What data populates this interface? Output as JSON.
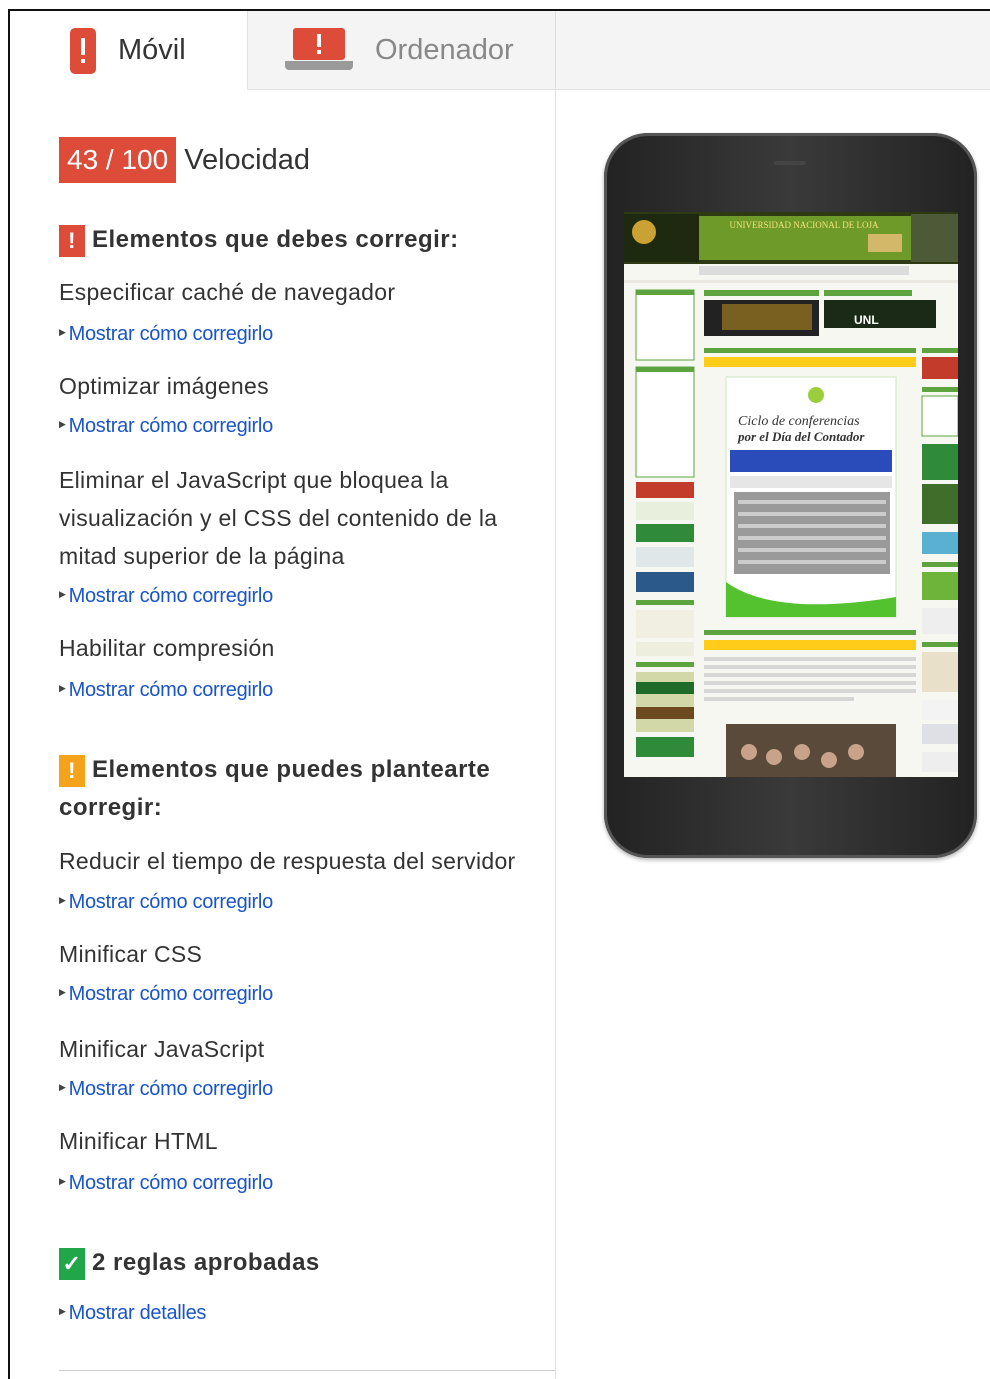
{
  "tabs": [
    {
      "label": "Móvil"
    },
    {
      "label": "Ordenador"
    }
  ],
  "score": {
    "value": "43 / 100",
    "label": "Velocidad"
  },
  "sections": {
    "must_fix": {
      "icon": "!",
      "title": "Elementos que debes corregir:",
      "rules": [
        {
          "title": "Especificar caché de navegador",
          "link": "Mostrar cómo corregirlo"
        },
        {
          "title": "Optimizar imágenes",
          "link": "Mostrar cómo corregirlo"
        },
        {
          "title_lines": [
            "Eliminar el JavaScript que bloquea la",
            "visualización y el CSS del contenido de la",
            "mitad superior de la página"
          ],
          "link": "Mostrar cómo corregirlo"
        },
        {
          "title": "Habilitar compresión",
          "link": "Mostrar cómo corregirlo"
        }
      ]
    },
    "should_fix": {
      "icon": "!",
      "title_lines": [
        "Elementos que puedes plantearte",
        "corregir:"
      ],
      "rules": [
        {
          "title": "Reducir el tiempo de respuesta del servidor",
          "link": "Mostrar cómo corregirlo"
        },
        {
          "title": "Minificar CSS",
          "link": "Mostrar cómo corregirlo"
        },
        {
          "title": "Minificar JavaScript",
          "link": "Mostrar cómo corregirlo"
        },
        {
          "title": "Minificar HTML",
          "link": "Mostrar cómo corregirlo"
        }
      ]
    },
    "passed": {
      "icon": "✓",
      "title": "2 reglas aprobadas",
      "link": "Mostrar detalles"
    }
  },
  "preview": {
    "site_banner": "UNIVERSIDAD NACIONAL DE LOJA",
    "promo_heading_1": "Ciclo de conferencias",
    "promo_heading_2": "por el Día del Contador",
    "badge_text": "UNL"
  },
  "colors": {
    "red": "#dd4b39",
    "orange": "#f6a31c",
    "green": "#21a74a",
    "link": "#1a55c8"
  }
}
